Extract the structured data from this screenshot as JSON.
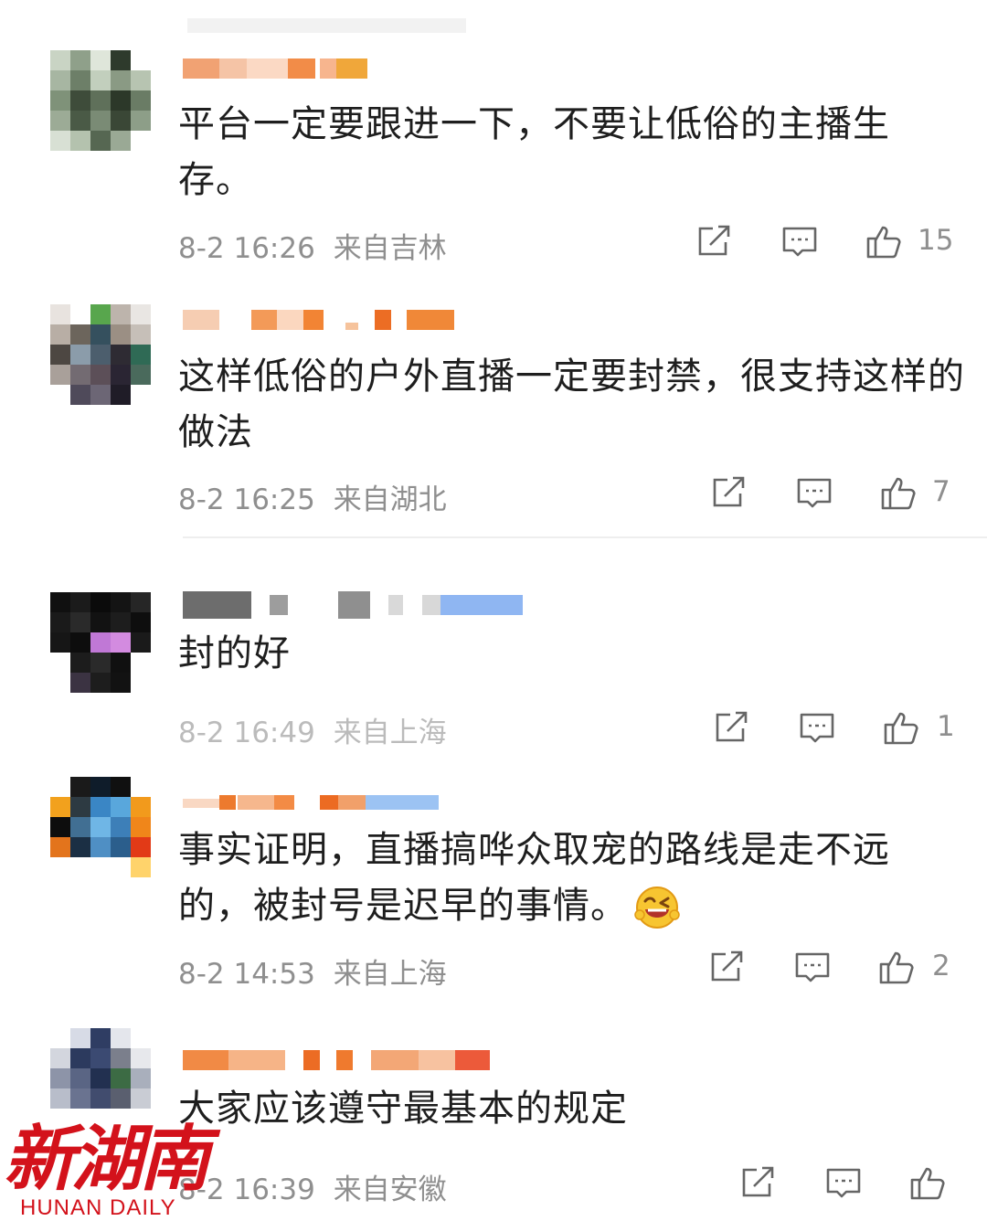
{
  "comments": [
    {
      "text": "平台一定要跟进一下，不要让低俗的主播生存。",
      "time": "8-2 16:26",
      "location": "来自吉林",
      "likes": "15"
    },
    {
      "text": "这样低俗的户外直播一定要封禁，很支持这样的做法",
      "time": "8-2 16:25",
      "location": "来自湖北",
      "likes": "7"
    },
    {
      "text": "封的好",
      "time": "8-2 16:49",
      "location": "来自上海",
      "likes": "1"
    },
    {
      "text": "事实证明，直播搞哗众取宠的路线是走不远的，被封号是迟早的事情。",
      "time": "8-2 14:53",
      "location": "来自上海",
      "likes": "2",
      "emoji": "laughing-face-emoji"
    },
    {
      "text": "大家应该遵守最基本的规定",
      "time": "8-2 16:39",
      "location": "来自安徽",
      "likes": ""
    }
  ],
  "icons": {
    "share": "share-icon",
    "reply": "comment-icon",
    "like": "thumbs-up-icon"
  },
  "watermark": {
    "chinese": "新湖南",
    "english": "HUNAN DAILY"
  },
  "colors": {
    "meta_gray": "#8f8f8f",
    "watermark_red": "#d3121b"
  }
}
